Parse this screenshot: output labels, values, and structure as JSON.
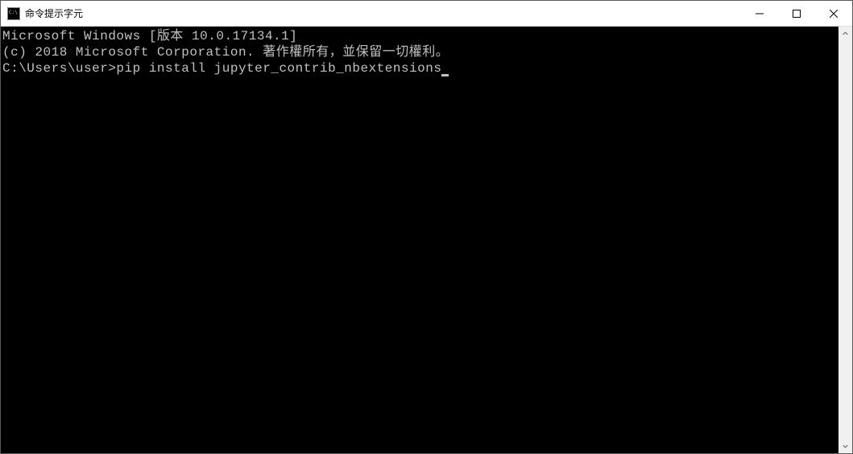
{
  "window": {
    "title": "命令提示字元"
  },
  "terminal": {
    "line1": "Microsoft Windows [版本 10.0.17134.1]",
    "line2": "(c) 2018 Microsoft Corporation. 著作權所有，並保留一切權利。",
    "line3": "",
    "prompt": "C:\\Users\\user>",
    "command": "pip install jupyter_contrib_nbextensions"
  }
}
